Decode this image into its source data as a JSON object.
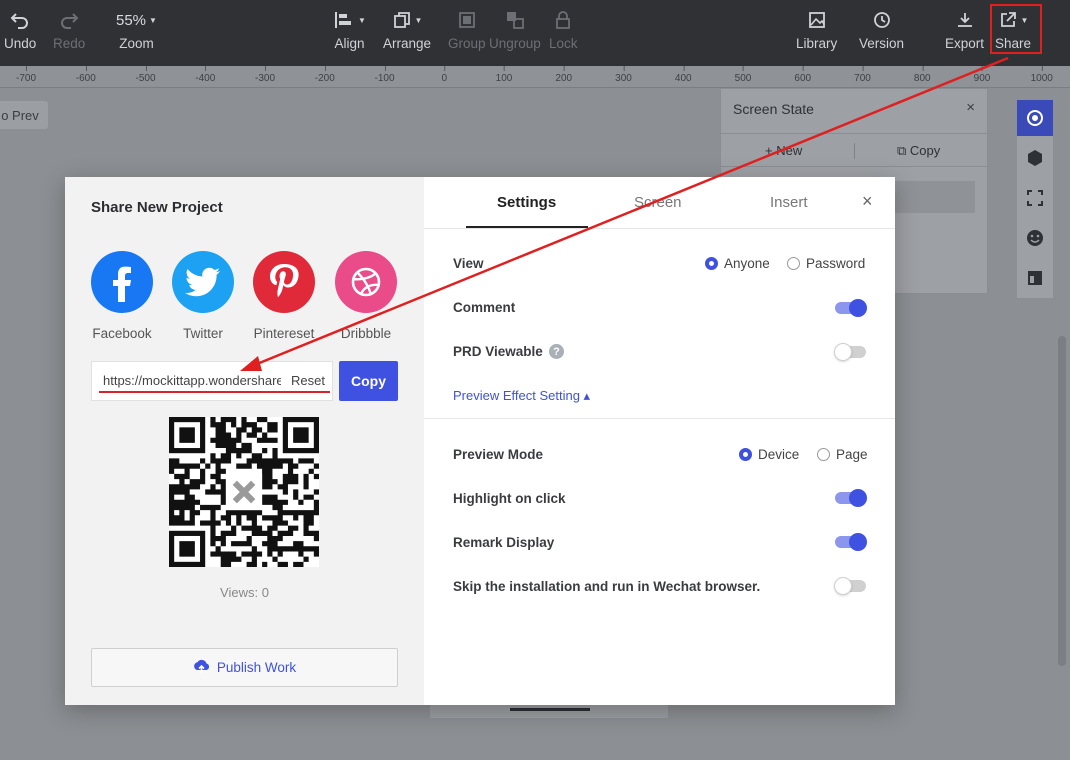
{
  "toolbar": {
    "undo": "Undo",
    "redo": "Redo",
    "zoom_value": "55%",
    "zoom": "Zoom",
    "align": "Align",
    "arrange": "Arrange",
    "group": "Group",
    "ungroup": "Ungroup",
    "lock": "Lock",
    "library": "Library",
    "version": "Version",
    "export": "Export",
    "share": "Share"
  },
  "ruler": [
    "-700",
    "-600",
    "-500",
    "-400",
    "-300",
    "-200",
    "-100",
    "0",
    "100",
    "200",
    "300",
    "400",
    "500",
    "600",
    "700",
    "800",
    "900",
    "1000"
  ],
  "canvas": {
    "prev_label": "o Prev"
  },
  "screen_state": {
    "title": "Screen State",
    "close": "×",
    "new": "New",
    "copy": "Copy"
  },
  "modal": {
    "title": "Share New Project",
    "socials": [
      {
        "name": "Facebook",
        "color": "#1877f2"
      },
      {
        "name": "Twitter",
        "color": "#1da1f2"
      },
      {
        "name": "Pintereset",
        "color": "#e02a3a"
      },
      {
        "name": "Dribbble",
        "color": "#ea4c89"
      }
    ],
    "link_value": "https://mockittapp.wondershare.com/share",
    "reset": "Reset",
    "copy": "Copy",
    "views": "Views:  0",
    "publish": "Publish Work",
    "tabs": [
      "Settings",
      "Screen",
      "Insert"
    ],
    "close": "×",
    "settings": {
      "view_label": "View",
      "view_options": [
        "Anyone",
        "Password"
      ],
      "view_selected": "Anyone",
      "comment_label": "Comment",
      "comment_on": true,
      "prd_label": "PRD Viewable",
      "prd_help": "?",
      "prd_on": false,
      "preview_effect": "Preview Effect Setting ▴",
      "preview_mode_label": "Preview Mode",
      "preview_mode_options": [
        "Device",
        "Page"
      ],
      "preview_mode_selected": "Device",
      "highlight_label": "Highlight on click",
      "highlight_on": true,
      "remark_label": "Remark Display",
      "remark_on": true,
      "wechat_label": "Skip the installation and run in Wechat browser.",
      "wechat_on": false
    }
  },
  "colors": {
    "accent": "#3f51e0",
    "annotation": "#e02020",
    "toolbar_bg": "#2f3135"
  }
}
